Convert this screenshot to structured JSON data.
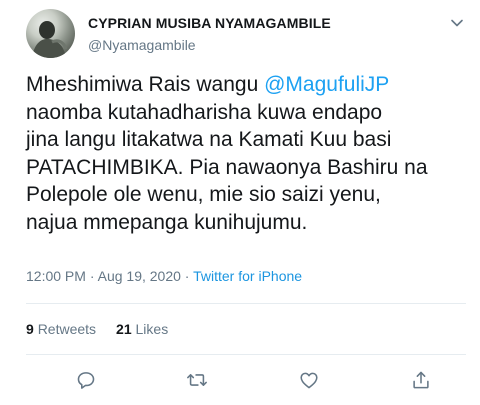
{
  "tweet": {
    "author": {
      "name": "CYPRIAN MUSIBA NYAMAGAMBILE",
      "handle": "@Nyamagambile"
    },
    "body": {
      "part1": "Mheshimiwa Rais wangu ",
      "mention": "@MagufuliJP",
      "part2": "\nnaomba kutahadharisha kuwa endapo\njina langu litakatwa na Kamati Kuu basi\nPATACHIMBIKA. Pia nawaonya Bashiru na\nPolepole ole wenu, mie sio saizi yenu,\nnajua mmepanga kunihujumu."
    },
    "meta": {
      "time": "12:00 PM",
      "separator1": " · ",
      "date": "Aug 19, 2020",
      "separator2": " · ",
      "source": "Twitter for iPhone"
    },
    "stats": {
      "retweets_count": "9",
      "retweets_label": "Retweets",
      "likes_count": "21",
      "likes_label": "Likes"
    },
    "icons": {
      "caret": "chevron-down-icon",
      "reply": "reply-icon",
      "retweet": "retweet-icon",
      "like": "heart-icon",
      "share": "share-icon"
    },
    "colors": {
      "text": "#14171a",
      "secondary": "#657786",
      "link": "#1da1f2",
      "divider": "#e6ecf0"
    }
  }
}
